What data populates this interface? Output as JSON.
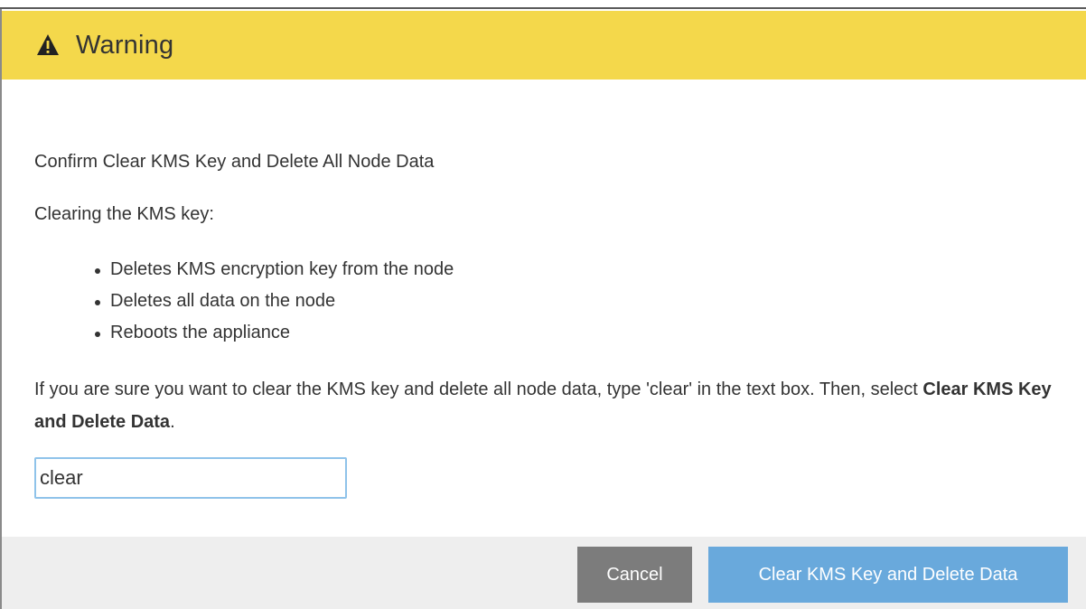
{
  "dialog": {
    "title": "Warning",
    "title_icon": "warning-triangle-icon",
    "header_color": "#f4d84b",
    "confirm_heading": "Confirm Clear KMS Key and Delete All Node Data",
    "clearing_intro": "Clearing the KMS key:",
    "bullets": [
      "Deletes KMS encryption key from the node",
      "Deletes all data on the node",
      "Reboots the appliance"
    ],
    "instructions_prefix": "If you are sure you want to clear the KMS key and delete all node data, type 'clear' in the text box. Then, select ",
    "instructions_bold": "Clear KMS Key and Delete Data",
    "instructions_suffix": ".",
    "input_value": "clear",
    "cancel_label": "Cancel",
    "confirm_label": "Clear KMS Key and Delete Data",
    "cancel_color": "#7c7c7c",
    "confirm_color": "#69a9dc"
  }
}
